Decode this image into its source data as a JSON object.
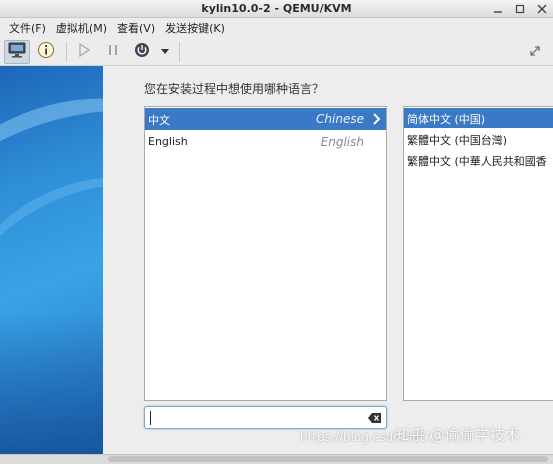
{
  "window": {
    "title": "kylin10.0-2 - QEMU/KVM"
  },
  "menubar": {
    "items": [
      "文件(F)",
      "虚拟机(M)",
      "查看(V)",
      "发送按键(K)"
    ]
  },
  "toolbar": {
    "buttons": [
      "monitor-icon",
      "info-icon",
      "play-icon",
      "pause-icon",
      "power-icon",
      "dropdown-arrow-icon"
    ],
    "fullscreen": "resize-icon"
  },
  "installer": {
    "question": "您在安装过程中想使用哪种语言？",
    "languages": [
      {
        "native": "中文",
        "english": "Chinese",
        "selected": true
      },
      {
        "native": "English",
        "english": "English",
        "selected": false
      }
    ],
    "locales": [
      {
        "label": "简体中文 (中国)",
        "selected": true
      },
      {
        "label": "繁體中文 (中国台灣)",
        "selected": false
      },
      {
        "label": "繁體中文 (中華人民共和國香",
        "selected": false
      }
    ],
    "search": {
      "value": "",
      "placeholder": ""
    }
  },
  "watermark": {
    "url": "https://blog.csdn.net/...",
    "zhihu": "知乎 @偷偷学技术"
  },
  "colors": {
    "selection": "#3b79c6",
    "sidebar": "#2f8fd8"
  }
}
